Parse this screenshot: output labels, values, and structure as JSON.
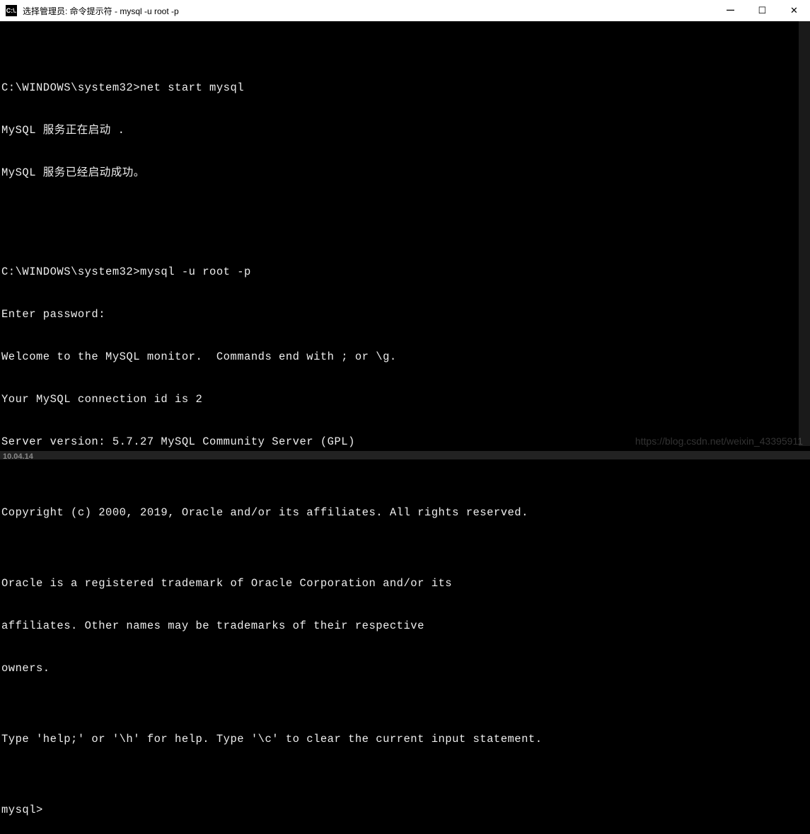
{
  "titlebar": {
    "icon_label": "C:\\.",
    "title": "选择管理员: 命令提示符 - mysql  -u root -p"
  },
  "window_controls": {
    "minimize": "—",
    "maximize": "☐",
    "close": "✕"
  },
  "terminal": {
    "lines": [
      "",
      "C:\\WINDOWS\\system32>net start mysql",
      "MySQL 服务正在启动 .",
      "MySQL 服务已经启动成功。",
      "",
      "",
      "C:\\WINDOWS\\system32>mysql -u root -p",
      "Enter password:",
      "Welcome to the MySQL monitor.  Commands end with ; or \\g.",
      "Your MySQL connection id is 2",
      "Server version: 5.7.27 MySQL Community Server (GPL)",
      "",
      "Copyright (c) 2000, 2019, Oracle and/or its affiliates. All rights reserved.",
      "",
      "Oracle is a registered trademark of Oracle Corporation and/or its",
      "affiliates. Other names may be trademarks of their respective",
      "owners.",
      "",
      "Type 'help;' or '\\h' for help. Type '\\c' to clear the current input statement.",
      "",
      "mysql>"
    ]
  },
  "watermark": "https://blog.csdn.net/weixin_43395911",
  "taskbar": {
    "time_fragment": "10.04.14"
  }
}
